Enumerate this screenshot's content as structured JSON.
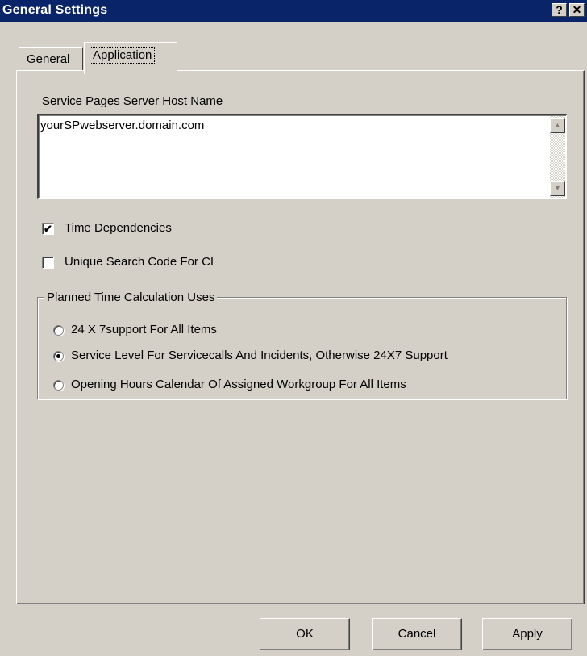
{
  "window": {
    "title": "General Settings",
    "help_glyph": "?",
    "close_glyph": "✕"
  },
  "tabs": [
    {
      "label": "General"
    },
    {
      "label": "Application"
    }
  ],
  "host": {
    "label": "Service Pages Server Host Name",
    "value": "yourSPwebserver.domain.com"
  },
  "checkboxes": [
    {
      "label": "Time Dependencies",
      "checked": true
    },
    {
      "label": "Unique Search Code For CI",
      "checked": false
    }
  ],
  "planned_time": {
    "legend": "Planned Time Calculation Uses",
    "options": [
      {
        "label": "24 X 7support For All Items",
        "selected": false
      },
      {
        "label": "Service Level For Servicecalls And Incidents, Otherwise 24X7 Support",
        "selected": true
      },
      {
        "label": "Opening Hours Calendar Of Assigned Workgroup For All Items",
        "selected": false
      }
    ]
  },
  "buttons": {
    "ok": "OK",
    "cancel": "Cancel",
    "apply": "Apply"
  },
  "scroll_glyphs": {
    "up": "▲",
    "down": "▼"
  },
  "check_glyph": "✔"
}
